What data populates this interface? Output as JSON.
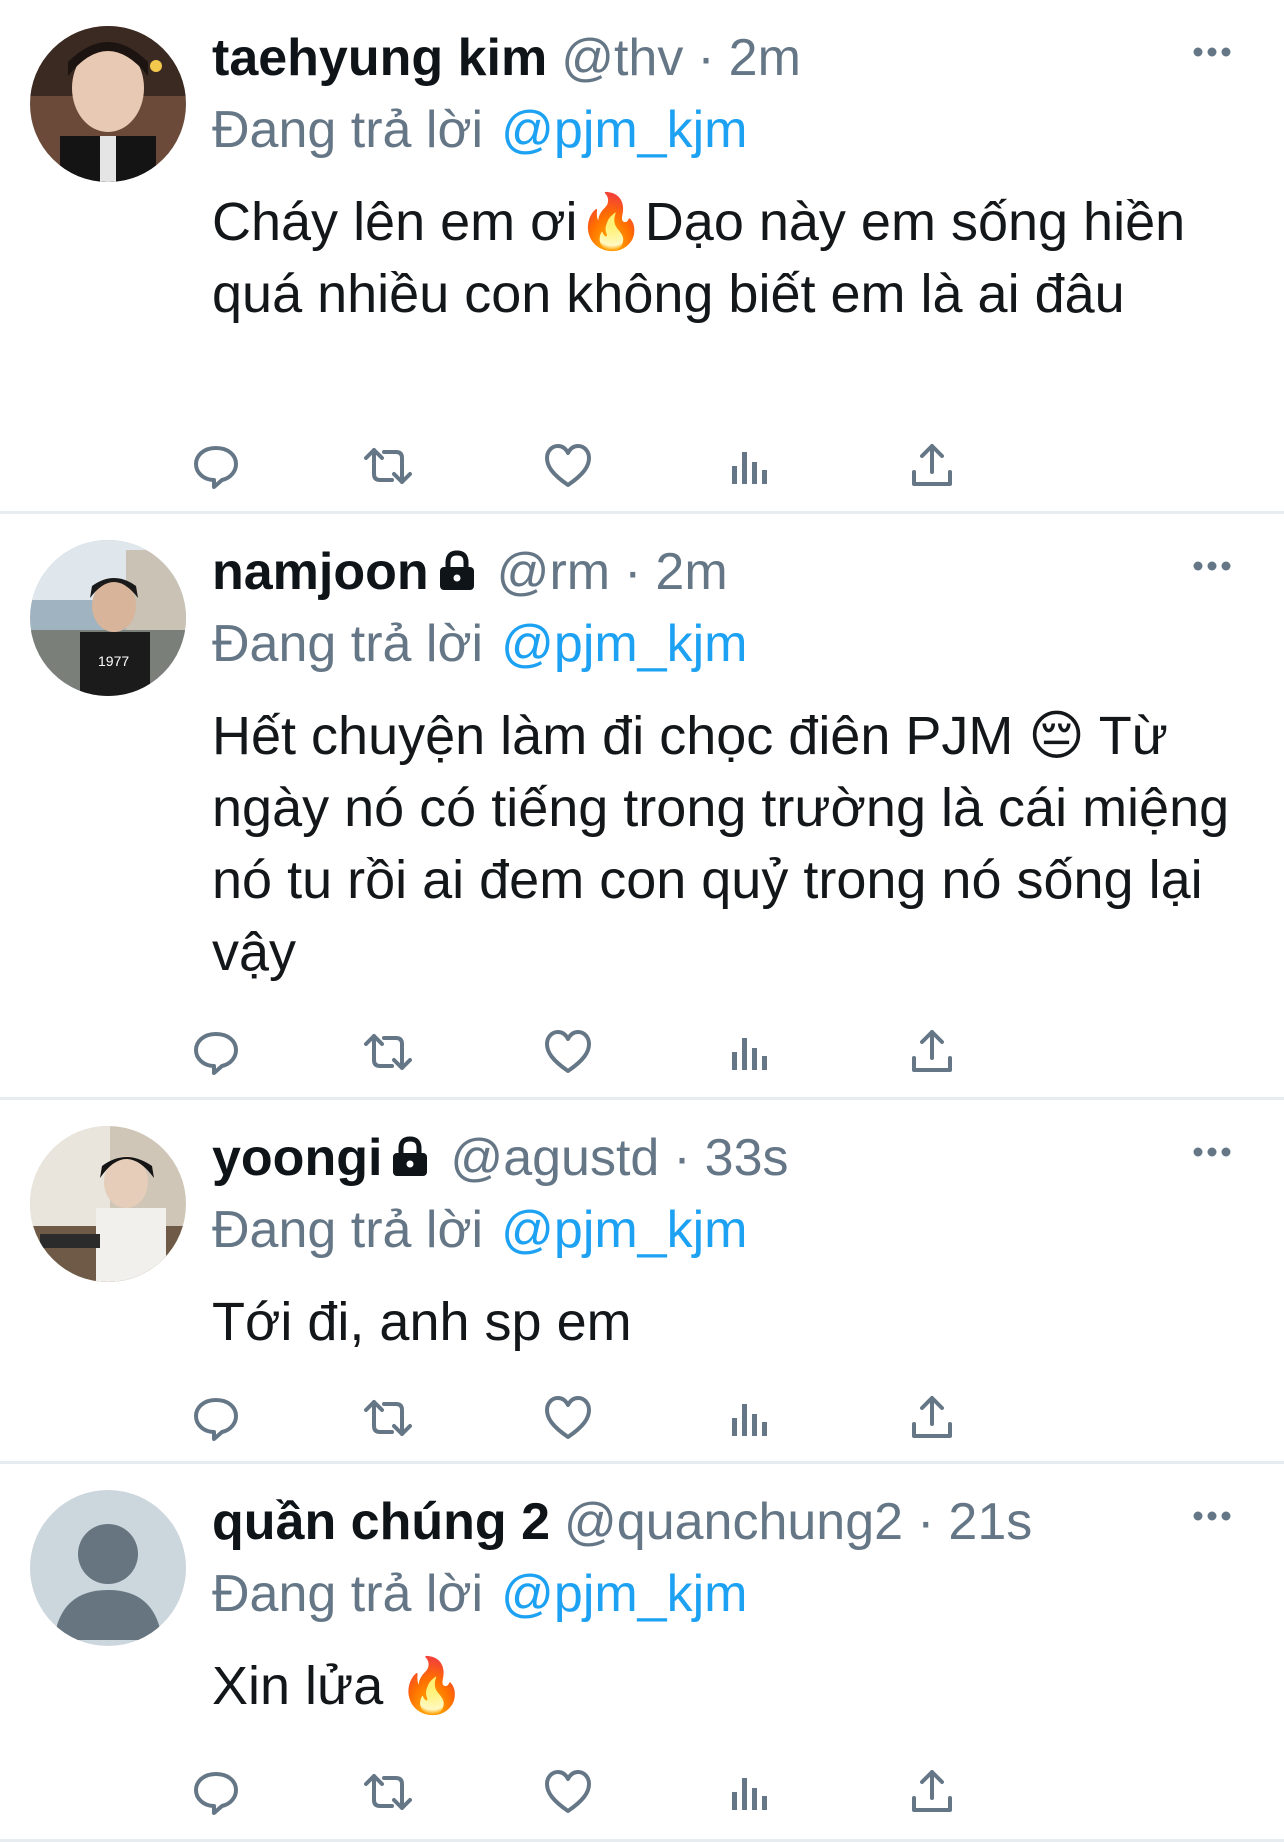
{
  "colors": {
    "handle_gray": "#657786",
    "link_blue": "#1da1f2",
    "icon_gray": "#657786",
    "divider": "#e6ecf0"
  },
  "tweets": [
    {
      "name": "taehyung kim",
      "locked": false,
      "handle": "@thv",
      "separator": "·",
      "time": "2m",
      "reply_prefix": "Đang trả lời",
      "reply_target": "@pjm_kjm",
      "text": "Cháy lên em ơi🔥Dạo này em sống hiền quá nhiều con không biết em là ai đâu",
      "avatar": "photo"
    },
    {
      "name": "namjoon",
      "locked": true,
      "handle": "@rm",
      "separator": "·",
      "time": "2m",
      "reply_prefix": "Đang trả lời",
      "reply_target": "@pjm_kjm",
      "text": "Hết chuyện làm đi chọc điên PJM 😔 Từ ngày nó có tiếng trong trường là cái miệng nó tu rồi ai đem con quỷ trong nó sống lại vậy",
      "avatar": "photo"
    },
    {
      "name": "yoongi",
      "locked": true,
      "handle": "@agustd",
      "separator": "·",
      "time": "33s",
      "reply_prefix": "Đang trả lời",
      "reply_target": "@pjm_kjm",
      "text": "Tới đi, anh sp em",
      "avatar": "photo"
    },
    {
      "name": "quần chúng 2",
      "locked": false,
      "handle": "@quanchung2",
      "separator": "·",
      "time": "21s",
      "reply_prefix": "Đang trả lời",
      "reply_target": "@pjm_kjm",
      "text": "Xin lửa 🔥",
      "avatar": "default-profile-icon"
    }
  ],
  "action_icons": [
    "reply-icon",
    "retweet-icon",
    "like-icon",
    "analytics-icon",
    "share-icon"
  ]
}
